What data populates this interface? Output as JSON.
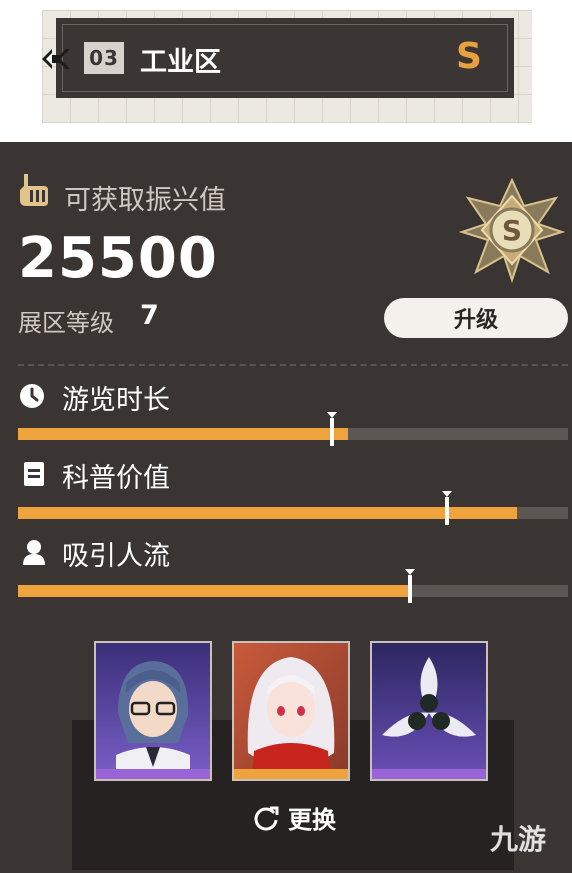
{
  "zone": {
    "number": "03",
    "name": "工业区",
    "rank": "S"
  },
  "summary": {
    "obtain_label": "可获取振兴值",
    "score": "25500",
    "level_label": "展区等级",
    "level_value": "7",
    "badge_letter": "S",
    "upgrade_label": "升级"
  },
  "stats": [
    {
      "label": "游览时长",
      "icon": "clock-icon",
      "fill": 0.6,
      "marker": 0.57
    },
    {
      "label": "科普价值",
      "icon": "document-icon",
      "fill": 0.907,
      "marker": 0.78
    },
    {
      "label": "吸引人流",
      "icon": "person-icon",
      "fill": 0.713,
      "marker": 0.713
    }
  ],
  "characters": [
    {
      "icon": "character-glasses-avatar",
      "strip_color": "#9a63d6"
    },
    {
      "icon": "character-white-hair-avatar",
      "strip_color": "#eea33c"
    },
    {
      "icon": "flower-item-avatar",
      "strip_color": "#9a63d6"
    }
  ],
  "swap_label": "更换",
  "watermark": "九游",
  "colors": {
    "accent": "#eea33c",
    "panel": "#3a3532",
    "track": "#5d5753"
  }
}
